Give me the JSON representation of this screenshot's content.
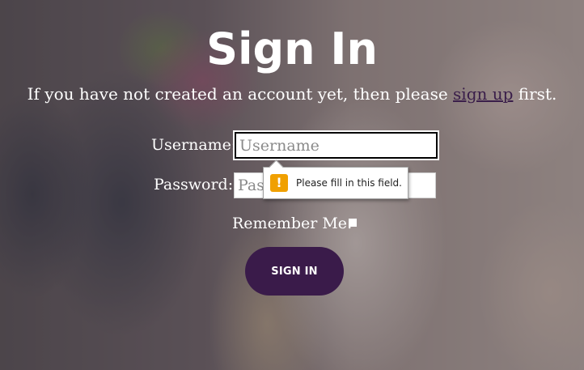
{
  "page": {
    "title": "Sign In",
    "intro_prefix": "If you have not created an account yet, then please ",
    "signup_link": "sign up",
    "intro_suffix": " first."
  },
  "form": {
    "username_label": "Username:",
    "username_placeholder": "Username",
    "username_value": "",
    "password_label": "Password:",
    "password_placeholder": "Password",
    "remember_label": "Remember Me:",
    "remember_checked": false,
    "submit_label": "SIGN IN"
  },
  "validation": {
    "icon": "warning-icon",
    "icon_glyph": "!",
    "message": "Please fill in this field."
  },
  "colors": {
    "accent": "#3a1b4a",
    "link": "#3a1e4a",
    "warning": "#f0a000"
  }
}
